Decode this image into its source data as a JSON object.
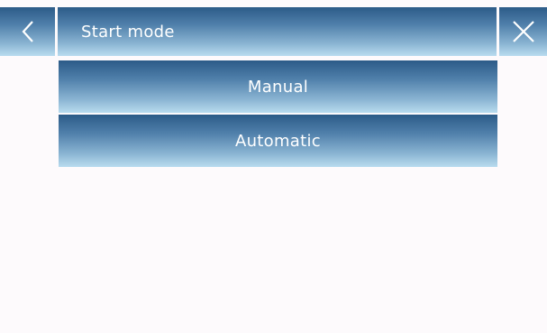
{
  "header": {
    "title": "Start mode",
    "back_icon": "chevron-left-icon",
    "close_icon": "close-icon"
  },
  "options": [
    {
      "label": "Manual"
    },
    {
      "label": "Automatic"
    }
  ],
  "colors": {
    "background": "#fdfafc",
    "bar_top": "#2c5b88",
    "bar_bottom": "#b9dcef",
    "text": "#ffffff"
  }
}
